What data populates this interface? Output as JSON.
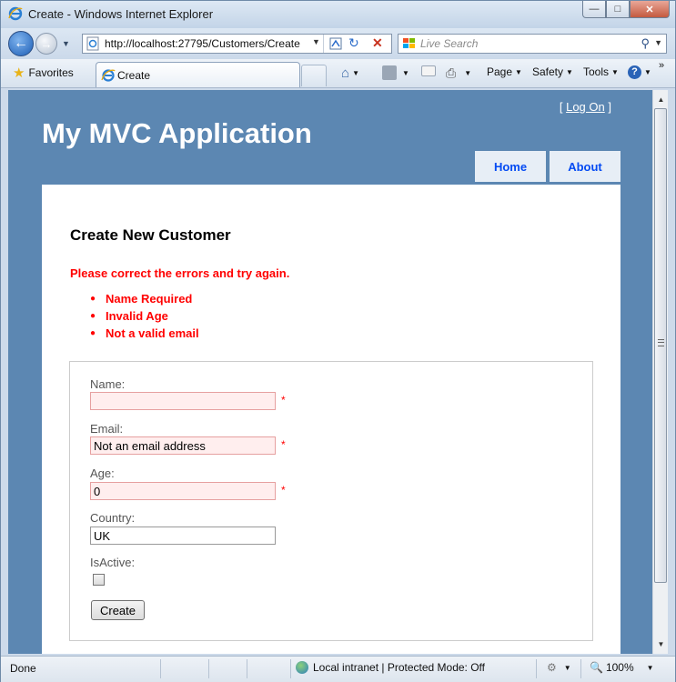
{
  "window": {
    "title": "Create - Windows Internet Explorer",
    "buttons": {
      "minimize": "—",
      "maximize": "□",
      "close": "✕"
    }
  },
  "address_bar": {
    "url": "http://localhost:27795/Customers/Create",
    "search_placeholder": "Live Search"
  },
  "command_bar": {
    "favorites_label": "Favorites",
    "tab_label": "Create",
    "page_label": "Page",
    "safety_label": "Safety",
    "tools_label": "Tools",
    "overflow": "»"
  },
  "site": {
    "logon_open": "[",
    "logon_label": "Log On",
    "logon_close": "]",
    "app_title": "My MVC Application",
    "menu": {
      "home": "Home",
      "about": "About"
    }
  },
  "form": {
    "title": "Create New Customer",
    "error_summary": "Please correct the errors and try again.",
    "errors": [
      "Name Required",
      "Invalid Age",
      "Not a valid email"
    ],
    "fields": {
      "name": {
        "label": "Name:",
        "value": ""
      },
      "email": {
        "label": "Email:",
        "value": "Not an email address"
      },
      "age": {
        "label": "Age:",
        "value": "0"
      },
      "country": {
        "label": "Country:",
        "value": "UK"
      },
      "isactive": {
        "label": "IsActive:",
        "checked": false
      }
    },
    "required_marker": "*",
    "submit_label": "Create"
  },
  "status_bar": {
    "status": "Done",
    "zone": "Local intranet | Protected Mode: Off",
    "zoom": "100%"
  },
  "colors": {
    "page_bg": "#5c87b2",
    "menu_bg": "#e7eef6",
    "menu_text": "#034af3",
    "error": "#ff0000"
  }
}
